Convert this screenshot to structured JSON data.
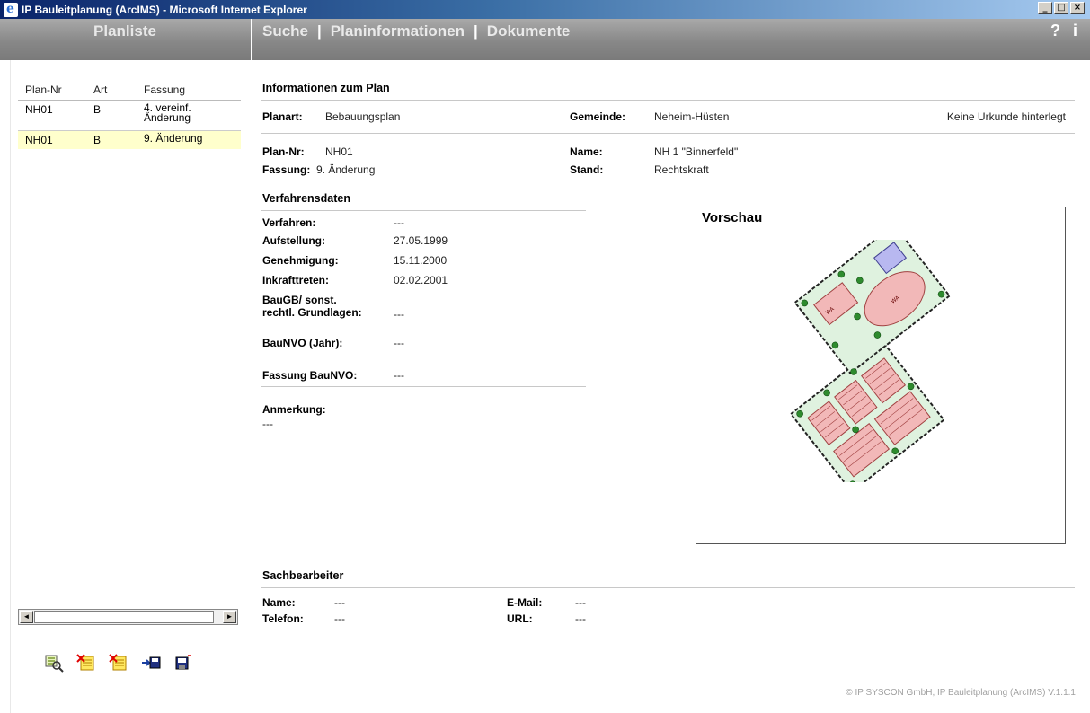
{
  "window": {
    "title": "IP Bauleitplanung (ArcIMS) - Microsoft Internet Explorer",
    "controls": [
      "_",
      "□",
      "×"
    ]
  },
  "nav": {
    "left_title": "Planliste",
    "tabs": [
      "Suche",
      "Planinformationen",
      "Dokumente"
    ],
    "separator": "|",
    "help": "?",
    "info": "i"
  },
  "planlist": {
    "columns": [
      "Plan-Nr",
      "Art",
      "Fassung"
    ],
    "rows": [
      {
        "nr": "NH01",
        "art": "B",
        "fassung": "4. vereinf. Änderung",
        "selected": false
      },
      {
        "nr": "NH01",
        "art": "B",
        "fassung": "9. Änderung",
        "selected": true
      }
    ],
    "scroll_left": "◄",
    "scroll_right": "►",
    "tools": [
      "zoom-to-plan-icon",
      "delete-list-icon",
      "clear-list-icon",
      "import-icon",
      "save-icon"
    ]
  },
  "info": {
    "header": "Informationen zum Plan",
    "planart_label": "Planart:",
    "planart_value": "Bebauungsplan",
    "gemeinde_label": "Gemeinde:",
    "gemeinde_value": "Neheim-Hüsten",
    "urkunde": "Keine Urkunde hinterlegt",
    "plannr_label": "Plan-Nr:",
    "plannr_value": "NH01",
    "name_label": "Name:",
    "name_value": "NH 1 \"Binnerfeld\"",
    "fassung_label": "Fassung:",
    "fassung_value": "9. Änderung",
    "stand_label": "Stand:",
    "stand_value": "Rechtskraft"
  },
  "verfahren": {
    "header": "Verfahrensdaten",
    "rows": [
      {
        "label": "Verfahren:",
        "value": "---"
      },
      {
        "label": "Aufstellung:",
        "value": "27.05.1999"
      },
      {
        "label": "Genehmigung:",
        "value": "15.11.2000"
      },
      {
        "label": "Inkrafttreten:",
        "value": "02.02.2001"
      }
    ],
    "baugb_label_1": "BauGB/ sonst.",
    "baugb_label_2": "rechtl. Grundlagen:",
    "baugb_value": "---",
    "baunvo_label": "BauNVO (Jahr):",
    "baunvo_value": "---",
    "fassung_baunvo_label": "Fassung BauNVO:",
    "fassung_baunvo_value": "---",
    "anmerkung_label": "Anmerkung:",
    "anmerkung_value": "---"
  },
  "preview": {
    "title": "Vorschau"
  },
  "sachbearbeiter": {
    "header": "Sachbearbeiter",
    "name_label": "Name:",
    "name_value": "---",
    "telefon_label": "Telefon:",
    "telefon_value": "---",
    "email_label": "E-Mail:",
    "email_value": "---",
    "url_label": "URL:",
    "url_value": "---"
  },
  "footer": "© IP SYSCON GmbH, IP Bauleitplanung (ArcIMS) V.1.1.1",
  "colors": {
    "selected_row": "#ffffcc",
    "navbar": "#888888"
  }
}
